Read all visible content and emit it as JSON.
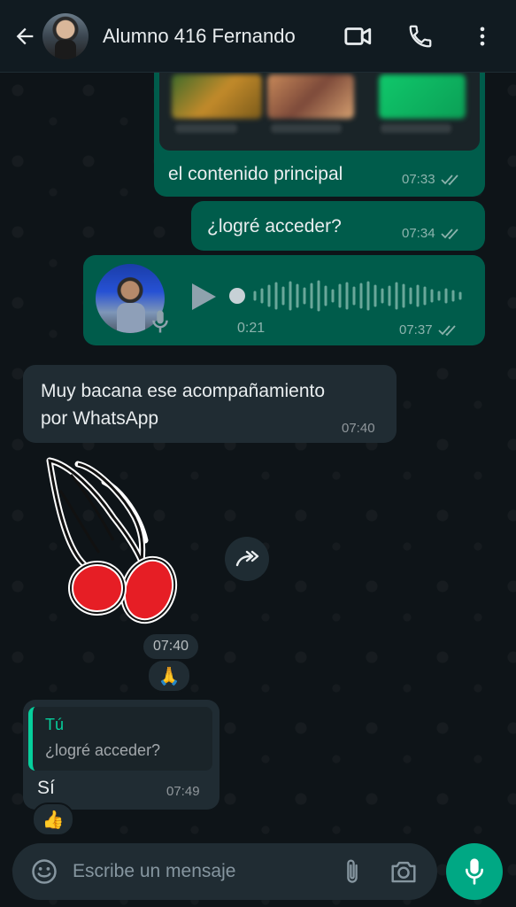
{
  "header": {
    "contact_name": "Alumno 416 Fernando",
    "icons": [
      "back-arrow-icon",
      "video-call-icon",
      "phone-icon",
      "more-vert-icon"
    ]
  },
  "messages": [
    {
      "type": "text",
      "direction": "outgoing",
      "text": "el contenido principal",
      "time": "07:33",
      "status": "read"
    },
    {
      "type": "text",
      "direction": "outgoing",
      "text": "¿logré acceder?",
      "time": "07:34",
      "status": "read"
    },
    {
      "type": "audio",
      "direction": "outgoing",
      "duration": "0:21",
      "time": "07:37",
      "status": "read"
    },
    {
      "type": "text",
      "direction": "incoming",
      "text_line1": "Muy bacana ese acompañamiento",
      "text_line2": "por WhatsApp",
      "time": "07:40"
    },
    {
      "type": "sticker",
      "direction": "incoming",
      "time": "07:40",
      "reaction": "🙏"
    },
    {
      "type": "reply",
      "direction": "incoming",
      "quoted_author": "Tú",
      "quoted_text": "¿logré acceder?",
      "text": "Sí",
      "time": "07:49",
      "reaction": "👍"
    }
  ],
  "composer": {
    "placeholder": "Escribe un mensaje"
  },
  "colors": {
    "outgoing_bubble": "#005c4b",
    "incoming_bubble": "#202c33",
    "accent": "#00a884",
    "background": "#0b141a"
  }
}
